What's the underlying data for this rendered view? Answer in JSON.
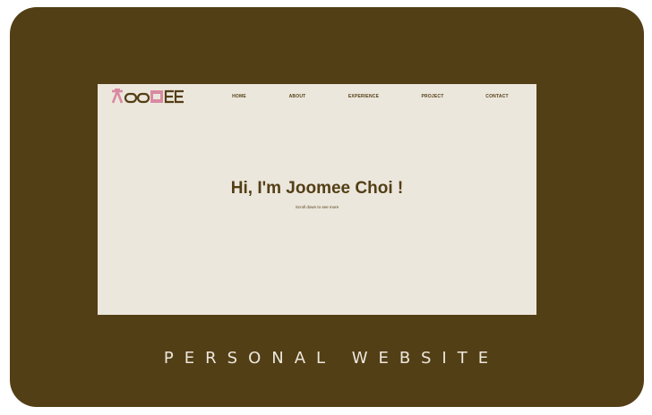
{
  "colors": {
    "frame": "#533f16",
    "screen_bg": "#ece7dc",
    "text_dark": "#533f16",
    "logo_pink": "#d98aa2",
    "caption": "#ece7dc"
  },
  "logo": {
    "text": "JOOMEE",
    "icon": "joomee-logo-icon"
  },
  "nav": {
    "items": [
      {
        "label": "HOME"
      },
      {
        "label": "ABOUT"
      },
      {
        "label": "EXPERIENCE"
      },
      {
        "label": "PROJECT"
      },
      {
        "label": "CONTACT"
      }
    ]
  },
  "hero": {
    "title": "Hi, I'm Joomee Choi !",
    "subtitle": "Scroll down to see more"
  },
  "caption": "PERSONAL WEBSITE"
}
